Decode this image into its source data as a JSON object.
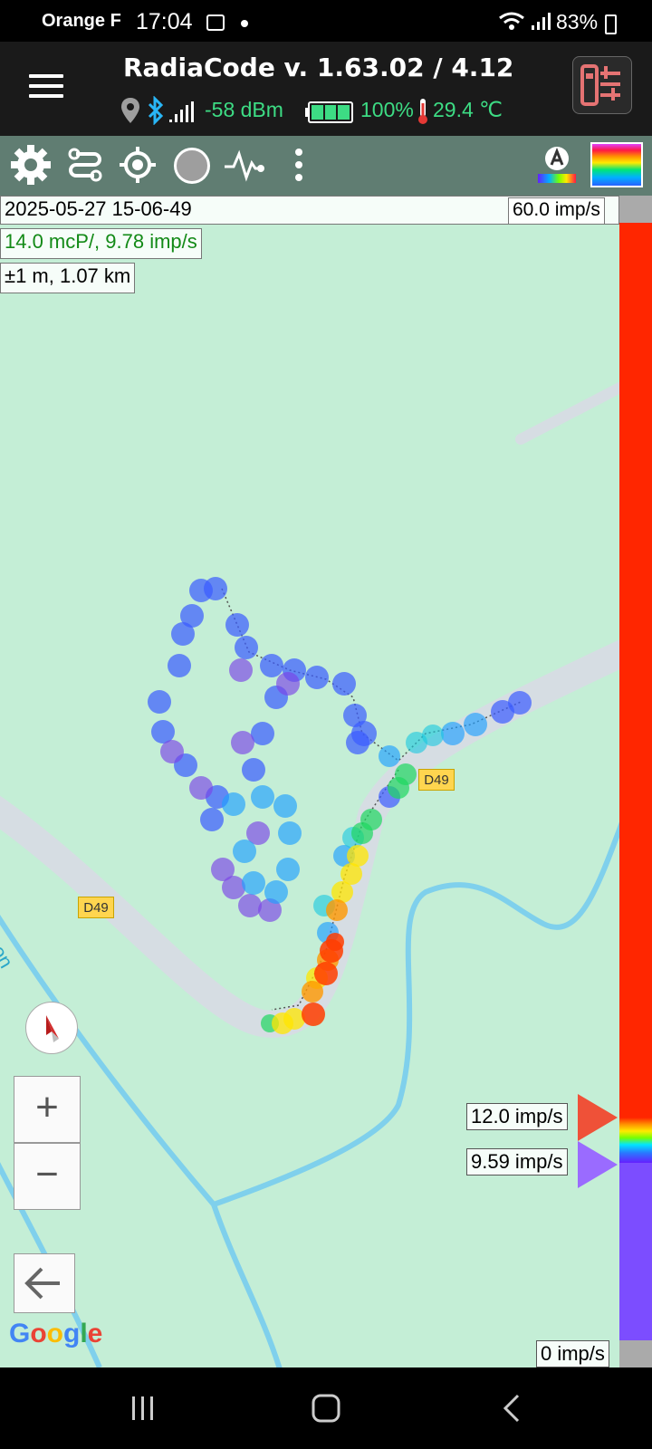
{
  "status_bar": {
    "carrier": "Orange F",
    "time": "17:04",
    "battery_percent": "83%"
  },
  "app_bar": {
    "title": "RadiaCode v. 1.63.02 / 4.12",
    "rssi": "-58 dBm",
    "device_battery": "100%",
    "temperature": "29.4 ℃"
  },
  "toolbar": {
    "icons": [
      "settings-icon",
      "track-icon",
      "gps-target-icon",
      "record-circle-icon",
      "pulse-icon",
      "more-vert-icon",
      "auto-scale-icon",
      "palette-icon"
    ]
  },
  "map_info": {
    "timestamp": "2025-05-27 15-06-49",
    "reading": "14.0 mcP/, 9.78 imp/s",
    "accuracy": "±1 m, 1.07 km"
  },
  "scale": {
    "max_label": "60.0 imp/s",
    "min_label": "0 imp/s",
    "upper_threshold": "12.0 imp/s",
    "lower_threshold": "9.59 imp/s"
  },
  "map": {
    "road_label_1": "D49",
    "road_label_2": "D49",
    "river_label": "son",
    "attribution": {
      "G": "G",
      "o1": "o",
      "o2": "o",
      "g": "g",
      "l": "l",
      "e": "e"
    }
  },
  "controls": {
    "zoom_in": "+",
    "zoom_out": "−"
  },
  "colors": {
    "scale_high": "#ff2600",
    "scale_low": "#7c4dff",
    "rssi_text": "#3ddc84"
  }
}
